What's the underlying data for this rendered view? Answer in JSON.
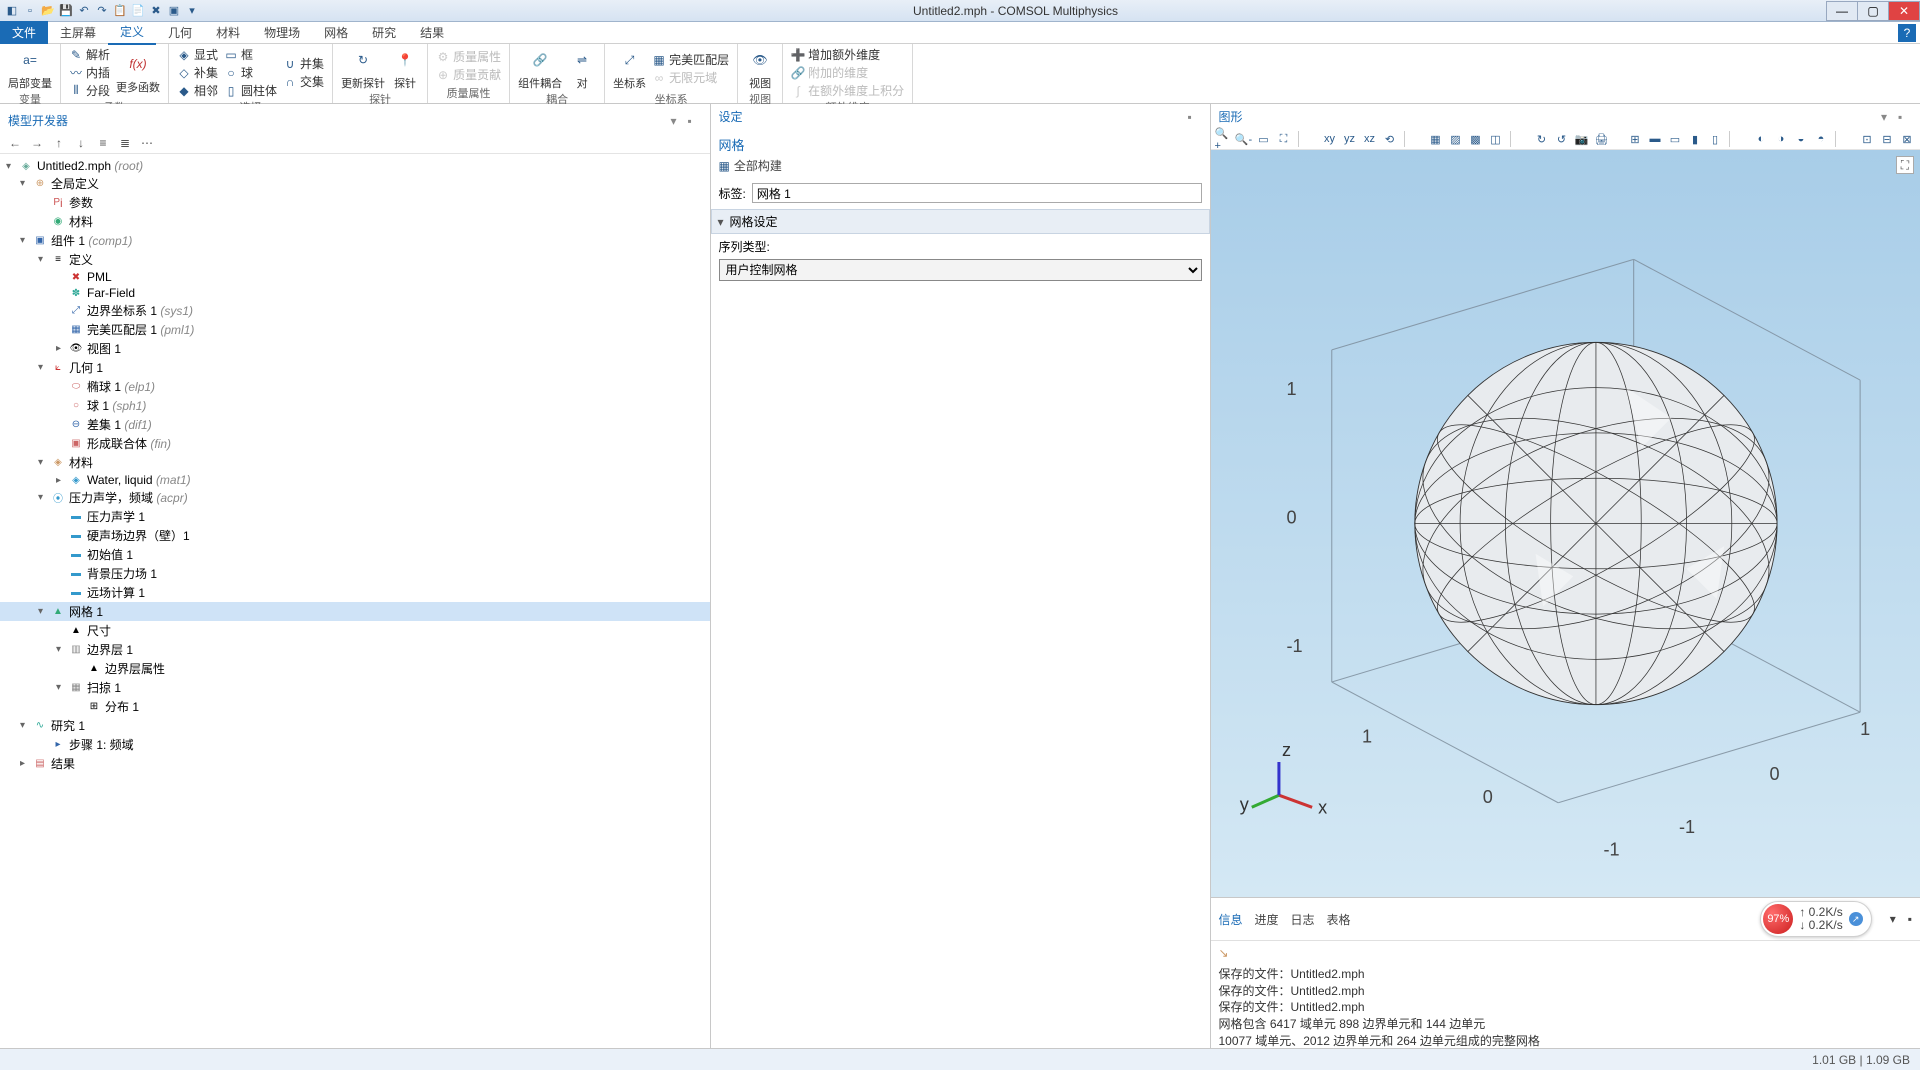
{
  "app": {
    "title": "Untitled2.mph - COMSOL Multiphysics"
  },
  "menu": {
    "file": "文件",
    "tabs": [
      "主屏幕",
      "定义",
      "几何",
      "材料",
      "物理场",
      "网格",
      "研究",
      "结果"
    ],
    "active": 1
  },
  "ribbon": {
    "g1": {
      "label": "变量",
      "localVar": "局部变量",
      "eq": "a="
    },
    "g2": {
      "label": "函数",
      "jiexi": "解析",
      "fx": "f(x)",
      "neicha": "内插",
      "fenduan": "分段",
      "more": "更多函数"
    },
    "g3": {
      "label": "选择",
      "xianshi": "显式",
      "kuang": "框",
      "xianglin": "相邻",
      "qiu": "球",
      "bingji": "并集",
      "jiaoji": "交集",
      "buji": "补集",
      "yuanzhu": "圆柱体"
    },
    "g4": {
      "label": "探针",
      "update": "更新探针",
      "probe": "探针"
    },
    "g5": {
      "label": "质量属性",
      "mass": "质量属性",
      "contrib": "质量贡献"
    },
    "g6": {
      "label": "耦合",
      "compCouple": "组件耦合",
      "pair": "对"
    },
    "g7": {
      "label": "坐标系",
      "coord": "坐标系",
      "pml": "完美匹配层",
      "inf": "无限元域"
    },
    "g8": {
      "label": "视图",
      "view": "视图"
    },
    "g9": {
      "label": "额外维度",
      "add": "增加额外维度",
      "attach": "附加的维度",
      "int": "在额外维度上积分"
    }
  },
  "treePanel": {
    "title": "模型开发器"
  },
  "tree": {
    "root": "Untitled2.mph",
    "rootSup": "(root)",
    "globdef": "全局定义",
    "params": "参数",
    "materials": "材料",
    "comp1": "组件 1",
    "comp1Sup": "(comp1)",
    "defs": "定义",
    "pml": "PML",
    "farfield": "Far-Field",
    "bsys": "边界坐标系 1",
    "bsysSup": "(sys1)",
    "pmlLayer": "完美匹配层 1",
    "pmlSup": "(pml1)",
    "view1": "视图 1",
    "geom": "几何 1",
    "elp": "椭球 1",
    "elpSup": "(elp1)",
    "sph": "球 1",
    "sphSup": "(sph1)",
    "diff": "差集 1",
    "diffSup": "(dif1)",
    "union": "形成联合体",
    "unionSup": "(fin)",
    "mat": "材料",
    "water": "Water, liquid",
    "waterSup": "(mat1)",
    "acpr": "压力声学，频域",
    "acprSup": "(acpr)",
    "ac1": "压力声学 1",
    "hard": "硬声场边界（壁）1",
    "init": "初始值 1",
    "bgfield": "背景压力场 1",
    "farcalc": "远场计算 1",
    "mesh": "网格 1",
    "size": "尺寸",
    "blayer": "边界层 1",
    "blattr": "边界层属性",
    "sweep": "扫掠 1",
    "dist": "分布 1",
    "study": "研究 1",
    "step": "步骤 1: 频域",
    "results": "结果"
  },
  "settings": {
    "title": "设定",
    "mesh": "网格",
    "buildAll": "全部构建",
    "labelLbl": "标签:",
    "labelVal": "网格 1",
    "section": "网格设定",
    "seqType": "序列类型:",
    "seqVal": "用户控制网格"
  },
  "graphics": {
    "title": "图形"
  },
  "infoTabs": {
    "info": "信息",
    "progress": "进度",
    "log": "日志",
    "table": "表格"
  },
  "logLines": [
    "保存的文件：Untitled2.mph",
    "保存的文件：Untitled2.mph",
    "保存的文件：Untitled2.mph",
    "网格包含 6417 域单元 898 边界单元和 144 边单元",
    "10077 域单元、2012 边界单元和 264 边单元组成的完整网格"
  ],
  "status": "1.01 GB | 1.09 GB",
  "widget": {
    "pct": "97%",
    "up": "0.2K/s",
    "dn": "0.2K/s"
  },
  "axis": {
    "x": "x",
    "y": "y",
    "z": "z",
    "ticks": [
      "-1",
      "0",
      "1"
    ]
  }
}
